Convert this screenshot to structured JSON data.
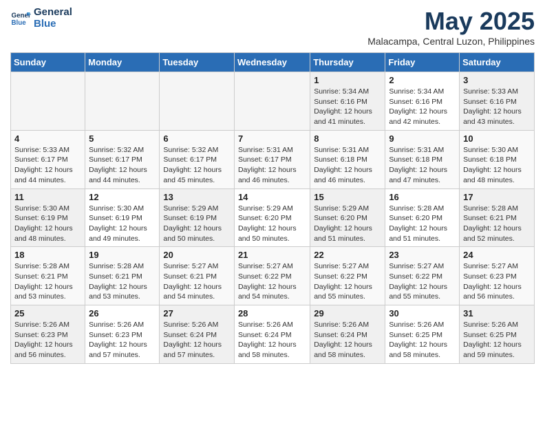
{
  "logo": {
    "line1": "General",
    "line2": "Blue"
  },
  "title": "May 2025",
  "location": "Malacampa, Central Luzon, Philippines",
  "days_of_week": [
    "Sunday",
    "Monday",
    "Tuesday",
    "Wednesday",
    "Thursday",
    "Friday",
    "Saturday"
  ],
  "weeks": [
    [
      {
        "num": "",
        "info": "",
        "empty": true
      },
      {
        "num": "",
        "info": "",
        "empty": true
      },
      {
        "num": "",
        "info": "",
        "empty": true
      },
      {
        "num": "",
        "info": "",
        "empty": true
      },
      {
        "num": "1",
        "info": "Sunrise: 5:34 AM\nSunset: 6:16 PM\nDaylight: 12 hours\nand 41 minutes."
      },
      {
        "num": "2",
        "info": "Sunrise: 5:34 AM\nSunset: 6:16 PM\nDaylight: 12 hours\nand 42 minutes."
      },
      {
        "num": "3",
        "info": "Sunrise: 5:33 AM\nSunset: 6:16 PM\nDaylight: 12 hours\nand 43 minutes."
      }
    ],
    [
      {
        "num": "4",
        "info": "Sunrise: 5:33 AM\nSunset: 6:17 PM\nDaylight: 12 hours\nand 44 minutes."
      },
      {
        "num": "5",
        "info": "Sunrise: 5:32 AM\nSunset: 6:17 PM\nDaylight: 12 hours\nand 44 minutes."
      },
      {
        "num": "6",
        "info": "Sunrise: 5:32 AM\nSunset: 6:17 PM\nDaylight: 12 hours\nand 45 minutes."
      },
      {
        "num": "7",
        "info": "Sunrise: 5:31 AM\nSunset: 6:17 PM\nDaylight: 12 hours\nand 46 minutes."
      },
      {
        "num": "8",
        "info": "Sunrise: 5:31 AM\nSunset: 6:18 PM\nDaylight: 12 hours\nand 46 minutes."
      },
      {
        "num": "9",
        "info": "Sunrise: 5:31 AM\nSunset: 6:18 PM\nDaylight: 12 hours\nand 47 minutes."
      },
      {
        "num": "10",
        "info": "Sunrise: 5:30 AM\nSunset: 6:18 PM\nDaylight: 12 hours\nand 48 minutes."
      }
    ],
    [
      {
        "num": "11",
        "info": "Sunrise: 5:30 AM\nSunset: 6:19 PM\nDaylight: 12 hours\nand 48 minutes."
      },
      {
        "num": "12",
        "info": "Sunrise: 5:30 AM\nSunset: 6:19 PM\nDaylight: 12 hours\nand 49 minutes."
      },
      {
        "num": "13",
        "info": "Sunrise: 5:29 AM\nSunset: 6:19 PM\nDaylight: 12 hours\nand 50 minutes."
      },
      {
        "num": "14",
        "info": "Sunrise: 5:29 AM\nSunset: 6:20 PM\nDaylight: 12 hours\nand 50 minutes."
      },
      {
        "num": "15",
        "info": "Sunrise: 5:29 AM\nSunset: 6:20 PM\nDaylight: 12 hours\nand 51 minutes."
      },
      {
        "num": "16",
        "info": "Sunrise: 5:28 AM\nSunset: 6:20 PM\nDaylight: 12 hours\nand 51 minutes."
      },
      {
        "num": "17",
        "info": "Sunrise: 5:28 AM\nSunset: 6:21 PM\nDaylight: 12 hours\nand 52 minutes."
      }
    ],
    [
      {
        "num": "18",
        "info": "Sunrise: 5:28 AM\nSunset: 6:21 PM\nDaylight: 12 hours\nand 53 minutes."
      },
      {
        "num": "19",
        "info": "Sunrise: 5:28 AM\nSunset: 6:21 PM\nDaylight: 12 hours\nand 53 minutes."
      },
      {
        "num": "20",
        "info": "Sunrise: 5:27 AM\nSunset: 6:21 PM\nDaylight: 12 hours\nand 54 minutes."
      },
      {
        "num": "21",
        "info": "Sunrise: 5:27 AM\nSunset: 6:22 PM\nDaylight: 12 hours\nand 54 minutes."
      },
      {
        "num": "22",
        "info": "Sunrise: 5:27 AM\nSunset: 6:22 PM\nDaylight: 12 hours\nand 55 minutes."
      },
      {
        "num": "23",
        "info": "Sunrise: 5:27 AM\nSunset: 6:22 PM\nDaylight: 12 hours\nand 55 minutes."
      },
      {
        "num": "24",
        "info": "Sunrise: 5:27 AM\nSunset: 6:23 PM\nDaylight: 12 hours\nand 56 minutes."
      }
    ],
    [
      {
        "num": "25",
        "info": "Sunrise: 5:26 AM\nSunset: 6:23 PM\nDaylight: 12 hours\nand 56 minutes."
      },
      {
        "num": "26",
        "info": "Sunrise: 5:26 AM\nSunset: 6:23 PM\nDaylight: 12 hours\nand 57 minutes."
      },
      {
        "num": "27",
        "info": "Sunrise: 5:26 AM\nSunset: 6:24 PM\nDaylight: 12 hours\nand 57 minutes."
      },
      {
        "num": "28",
        "info": "Sunrise: 5:26 AM\nSunset: 6:24 PM\nDaylight: 12 hours\nand 58 minutes."
      },
      {
        "num": "29",
        "info": "Sunrise: 5:26 AM\nSunset: 6:24 PM\nDaylight: 12 hours\nand 58 minutes."
      },
      {
        "num": "30",
        "info": "Sunrise: 5:26 AM\nSunset: 6:25 PM\nDaylight: 12 hours\nand 58 minutes."
      },
      {
        "num": "31",
        "info": "Sunrise: 5:26 AM\nSunset: 6:25 PM\nDaylight: 12 hours\nand 59 minutes."
      }
    ]
  ]
}
